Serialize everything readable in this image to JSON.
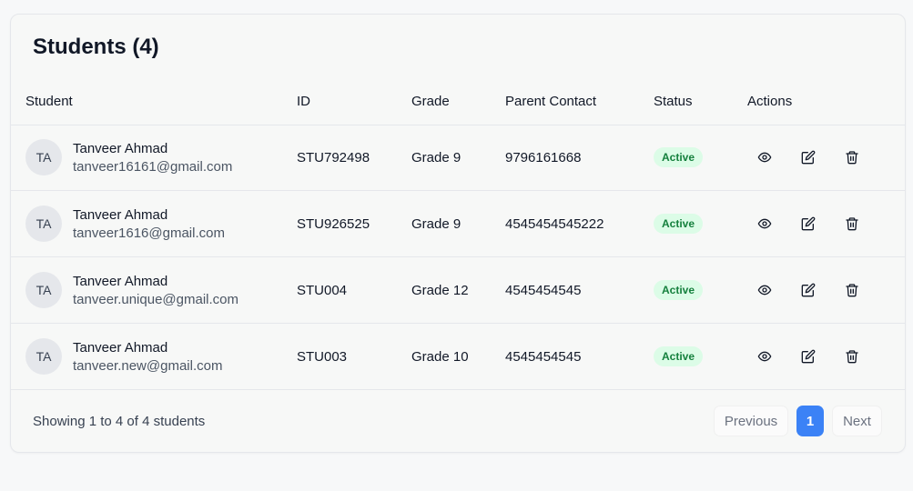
{
  "title": "Students (4)",
  "columns": {
    "student": "Student",
    "id": "ID",
    "grade": "Grade",
    "parent_contact": "Parent Contact",
    "status": "Status",
    "actions": "Actions"
  },
  "rows": [
    {
      "initials": "TA",
      "name": "Tanveer Ahmad",
      "email": "tanveer16161@gmail.com",
      "id": "STU792498",
      "grade": "Grade 9",
      "contact": "9796161668",
      "status": "Active"
    },
    {
      "initials": "TA",
      "name": "Tanveer Ahmad",
      "email": "tanveer1616@gmail.com",
      "id": "STU926525",
      "grade": "Grade 9",
      "contact": "4545454545222",
      "status": "Active"
    },
    {
      "initials": "TA",
      "name": "Tanveer Ahmad",
      "email": "tanveer.unique@gmail.com",
      "id": "STU004",
      "grade": "Grade 12",
      "contact": "4545454545",
      "status": "Active"
    },
    {
      "initials": "TA",
      "name": "Tanveer Ahmad",
      "email": "tanveer.new@gmail.com",
      "id": "STU003",
      "grade": "Grade 10",
      "contact": "4545454545",
      "status": "Active"
    }
  ],
  "action_icons": [
    "eye-icon",
    "edit-icon",
    "trash-icon"
  ],
  "footer": {
    "summary": "Showing 1 to 4 of 4 students",
    "previous": "Previous",
    "page": "1",
    "next": "Next"
  },
  "colors": {
    "accent": "#3b82f6",
    "badge_bg": "#dcfce7",
    "badge_text": "#15803d"
  }
}
